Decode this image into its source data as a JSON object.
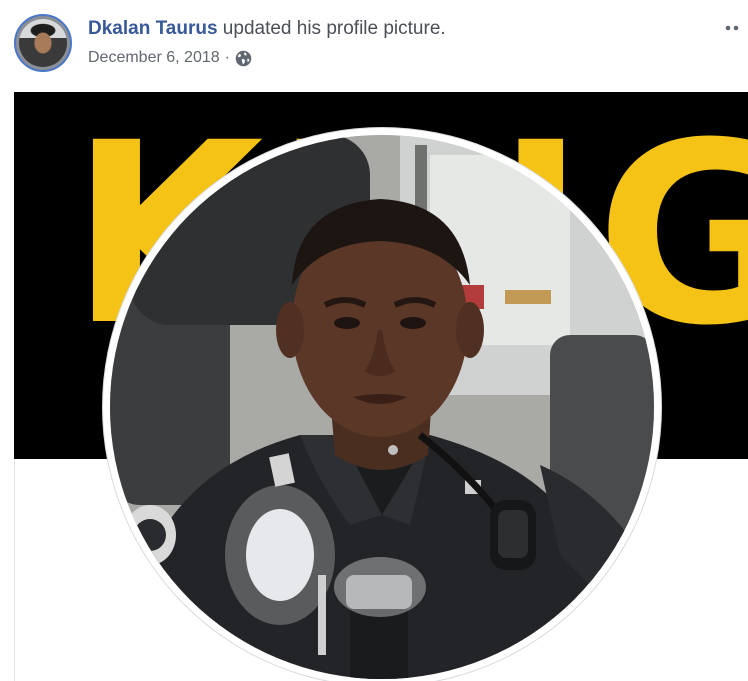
{
  "post": {
    "author": "Dkalan Taurus",
    "action": " updated his profile picture.",
    "date": "December 6, 2018",
    "separator": "·",
    "privacy_icon": "globe-icon",
    "more_icon": "more-options-icon"
  },
  "photo": {
    "cover_text": "KING",
    "cover_color": "#f5c315",
    "cover_background": "#000000"
  },
  "colors": {
    "author_link": "#385898",
    "avatar_ring": "#4a76c9",
    "meta_text": "#616770"
  }
}
